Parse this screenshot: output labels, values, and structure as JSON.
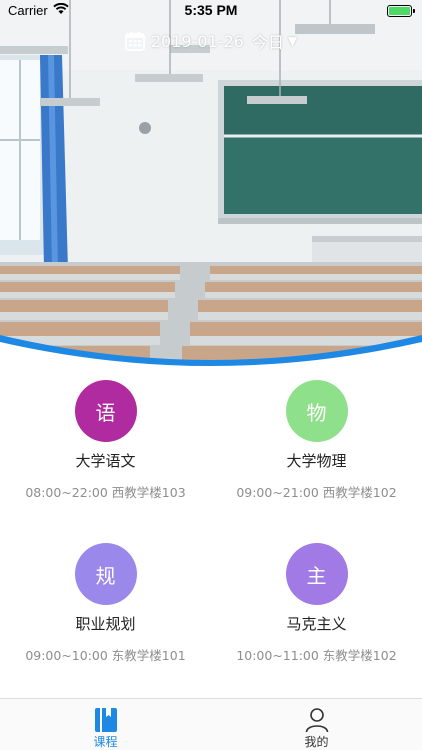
{
  "status_bar": {
    "carrier": "Carrier",
    "time": "5:35 PM",
    "battery_level": 1.0
  },
  "date_selector": {
    "date": "2019-01-26",
    "label": "今日",
    "icon": "calendar-icon",
    "caret_icon": "caret-down-icon"
  },
  "courses": [
    {
      "badge": "语",
      "name": "大学语文",
      "meta": "08:00~22:00 西教学楼103",
      "color": "#b02ba0"
    },
    {
      "badge": "物",
      "name": "大学物理",
      "meta": "09:00~21:00 西教学楼102",
      "color": "#8fe08a"
    },
    {
      "badge": "规",
      "name": "职业规划",
      "meta": "09:00~10:00 东教学楼101",
      "color": "#9a88ea"
    },
    {
      "badge": "主",
      "name": "马克主义",
      "meta": "10:00~11:00 东教学楼102",
      "color": "#a17ae6"
    }
  ],
  "tab_bar": {
    "tabs": [
      {
        "label": "课程",
        "icon": "book-icon",
        "active": true
      },
      {
        "label": "我的",
        "icon": "person-icon",
        "active": false
      }
    ],
    "active_color": "#1e88e5",
    "inactive_color": "#333333"
  },
  "accent_color": "#1e88e5"
}
